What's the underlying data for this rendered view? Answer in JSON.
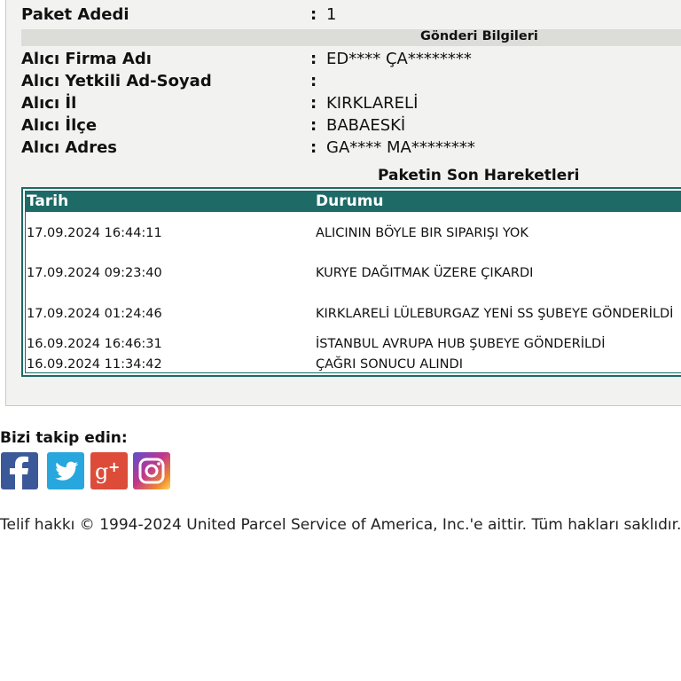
{
  "info": {
    "paket_label": "Paket Adedi",
    "paket_value": "1",
    "separator": ":",
    "section_title": "Gönderi Bilgileri",
    "rows": [
      {
        "label": "Alıcı Firma Adı",
        "value": "ED**** ÇA********"
      },
      {
        "label": "Alıcı Yetkili Ad-Soyad",
        "value": ""
      },
      {
        "label": "Alıcı İl",
        "value": "KIRKLARELİ"
      },
      {
        "label": "Alıcı İlçe",
        "value": "BABAESKİ"
      },
      {
        "label": "Alıcı Adres",
        "value": "GA**** MA********"
      }
    ]
  },
  "movements": {
    "title": "Paketin Son Hareketleri",
    "headers": {
      "date": "Tarih",
      "status": "Durumu"
    },
    "rows": [
      {
        "date": "17.09.2024 16:44:11",
        "status": "ALICININ BÖYLE BIR SIPARIŞI YOK"
      },
      {
        "date": "17.09.2024 09:23:40",
        "status": "KURYE DAĞITMAK ÜZERE ÇIKARDI"
      },
      {
        "date": "17.09.2024 01:24:46",
        "status": "KIRKLARELİ LÜLEBURGAZ YENİ SS ŞUBEYE GÖNDERİLDİ"
      },
      {
        "date": "16.09.2024 16:46:31",
        "status": "İSTANBUL AVRUPA HUB ŞUBEYE GÖNDERİLDİ"
      },
      {
        "date": "16.09.2024 11:34:42",
        "status": "ÇAĞRI SONUCU ALINDI"
      }
    ]
  },
  "social": {
    "follow_label": "Bizi takip edin:",
    "icons": [
      "facebook-icon",
      "twitter-icon",
      "google-plus-icon",
      "instagram-icon"
    ],
    "colors": {
      "facebook": "#3b5998",
      "twitter": "#27a7dd",
      "google_plus": "#dd4b39"
    }
  },
  "footer": {
    "copyright": "Telif hakkı © 1994-2024 United Parcel Service of America, Inc.'e aittir. Tüm hakları saklıdır."
  },
  "theme": {
    "table_header": "#1d6a66",
    "section_bar": "#dcdcd9",
    "panel_bg": "#f2f2f0"
  }
}
